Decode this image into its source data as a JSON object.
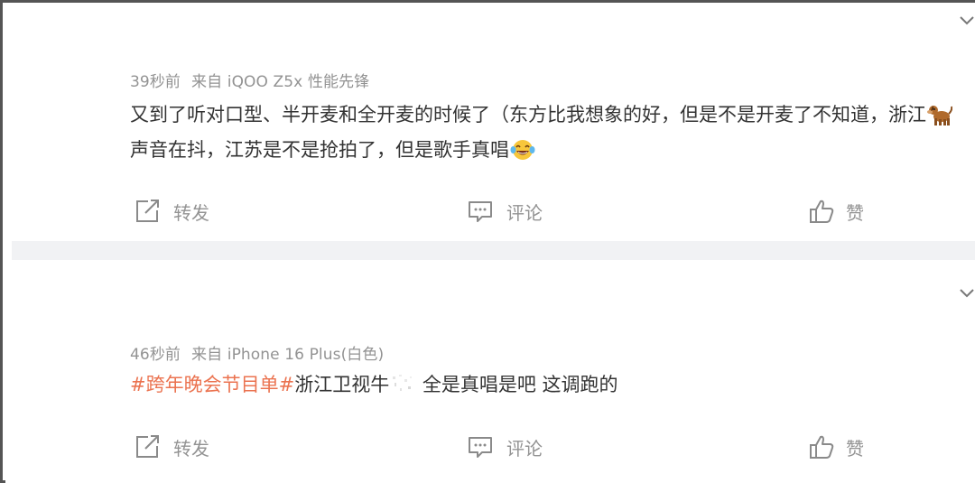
{
  "comments": [
    {
      "time": "39秒前",
      "source": "来自 iQOO Z5x 性能先锋",
      "text_part1": "又到了听对口型、半开麦和全开麦的时候了（东方比我想象的好，但是不是开麦了不知道，浙江",
      "emoji1": "dog-emoji",
      "text_part2": "声音在抖，江苏是不是抢拍了，但是歌手真唱",
      "emoji2": "laughing-crying-emoji",
      "repost_label": "转发",
      "comment_label": "评论",
      "like_label": "赞"
    },
    {
      "time": "46秒前",
      "source": "来自 iPhone 16 Plus(白色)",
      "hashtag": "#跨年晚会节目单#",
      "text_part1": "浙江卫视牛",
      "text_part2": " 全是真唱是吧 这调跑的",
      "repost_label": "转发",
      "comment_label": "评论",
      "like_label": "赞"
    }
  ],
  "colors": {
    "text": "#333333",
    "meta": "#939393",
    "hashtag": "#eb7350",
    "divider": "#f1f2f4",
    "frame": "#555555"
  },
  "icons": {
    "fold": "chevron-down-icon",
    "repost": "repost-icon",
    "comment": "comment-icon",
    "like": "thumbs-up-icon"
  }
}
